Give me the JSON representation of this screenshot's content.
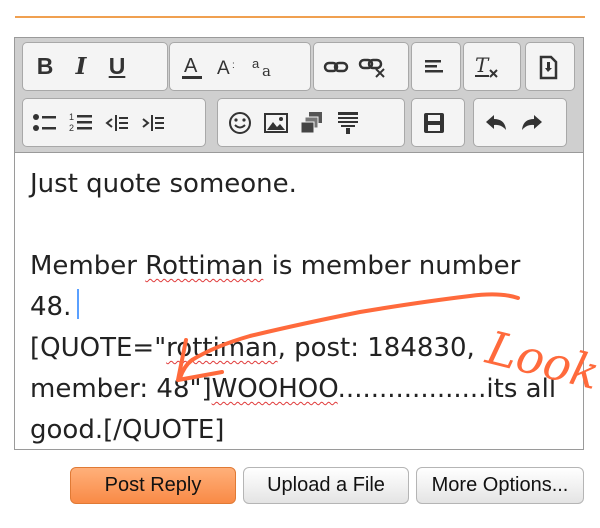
{
  "colors": {
    "accent": "#f98a46",
    "annotation": "#ff6a3c",
    "caret": "#5aa0ff",
    "spellcheck": "#e03a3a"
  },
  "toolbar": {
    "bold_label": "B",
    "italic_label": "I",
    "underline_label": "U",
    "icons": [
      "bold-icon",
      "italic-icon",
      "underline-icon",
      "font-color-icon",
      "font-size-icon",
      "font-family-icon",
      "link-icon",
      "unlink-icon",
      "align-icon",
      "remove-format-icon",
      "paste-icon",
      "bullet-list-icon",
      "numbered-list-icon",
      "outdent-icon",
      "indent-icon",
      "smiley-icon",
      "image-icon",
      "media-icon",
      "quote-icon",
      "save-draft-icon",
      "undo-icon",
      "redo-icon"
    ]
  },
  "editor": {
    "line1": "Just quote someone.",
    "line2_a": "Member ",
    "line2_b": "Rottiman",
    "line2_c": " is member number",
    "line3": "48.",
    "line4_a": "[QUOTE=\"",
    "line4_b": "rottiman",
    "line4_c": ", post: 184830,",
    "line5_a": "member: 48\"]",
    "line5_b": "WOOHOO",
    "line5_c": "..................its all",
    "line6": "good.[/QUOTE]"
  },
  "annotation": {
    "text": "Look"
  },
  "actions": {
    "post_reply": "Post Reply",
    "upload_file": "Upload a File",
    "more_options": "More Options..."
  }
}
